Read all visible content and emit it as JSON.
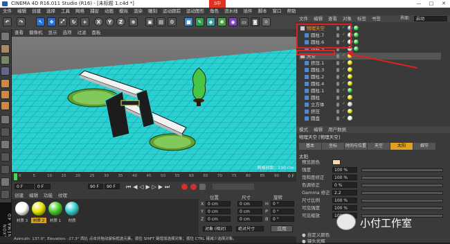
{
  "window": {
    "title": "CINEMA 4D R16.011 Studio (R16) - [未标题 1.c4d *]",
    "ime_label": "S中"
  },
  "menubar": [
    "文件",
    "编辑",
    "创建",
    "选择",
    "工具",
    "网格",
    "捕捉",
    "动画",
    "模拟",
    "渲染",
    "雕刻",
    "运动跟踪",
    "运动图形",
    "角色",
    "流水线",
    "插件",
    "脚本",
    "窗口",
    "帮助"
  ],
  "toolbar": {
    "xyz": [
      "X",
      "Y",
      "Z"
    ]
  },
  "viewport": {
    "menu": [
      "查看",
      "摄像机",
      "显示",
      "选项",
      "过滤",
      "面板"
    ],
    "grid_label": "网格间距：100 cm"
  },
  "timeline": {
    "ticks": [
      "0",
      "5",
      "10",
      "15",
      "20",
      "25",
      "30",
      "35",
      "40",
      "45",
      "50",
      "55",
      "60",
      "65",
      "70",
      "75",
      "80",
      "85",
      "90"
    ],
    "end": "0 F"
  },
  "transport": {
    "start": "0 F",
    "current": "0 F",
    "end": "90 F",
    "end2": "90 F"
  },
  "materials": {
    "menu": [
      "创建",
      "编辑",
      "功能",
      "纹理"
    ],
    "items": [
      {
        "name": "材质 3",
        "color": "#ffffff"
      },
      {
        "name": "材质 2",
        "color": "#e6e600"
      },
      {
        "name": "材质 1",
        "color": "#44cc22"
      },
      {
        "name": "材质",
        "color": "#33cccc"
      }
    ]
  },
  "coords": {
    "headers": [
      "位置",
      "尺寸",
      "旋转"
    ],
    "rows": [
      {
        "axis": "X",
        "pos": "0 cm",
        "size": "0 cm",
        "rlabel": "H",
        "rot": "0 °"
      },
      {
        "axis": "Y",
        "pos": "0 cm",
        "size": "0 cm",
        "rlabel": "P",
        "rot": "0 °"
      },
      {
        "axis": "Z",
        "pos": "0 cm",
        "size": "0 cm",
        "rlabel": "B",
        "rot": "0 °"
      }
    ],
    "mode": "对象 (相对)",
    "size_mode": "绝对尺寸",
    "apply": "应用"
  },
  "status": "Azimuth: 137.0°, Elevation: -27.3° 西比   点击并拖动鼠标框选元素。按住 SHIFT 键增加选择对象；按住 CTRL 键减少选择对象。",
  "objmgr": {
    "menu": [
      "文件",
      "编辑",
      "查看",
      "对象",
      "标签",
      "书签"
    ],
    "layout_label": "界面:",
    "layout_value": "启动",
    "rows": [
      {
        "name": "物理天空",
        "indent": 0,
        "tags": [
          "#4ad",
          "#3c3"
        ]
      },
      {
        "name": "圆柱.7",
        "indent": 1,
        "tags": [
          "#ccc",
          "#3c3"
        ]
      },
      {
        "name": "圆柱.6",
        "indent": 1,
        "tags": [
          "#ccc",
          "#3c3"
        ]
      },
      {
        "name": "圆柱.5",
        "indent": 1,
        "tags": [
          "#ccc",
          "#3c3"
        ]
      },
      {
        "name": "天空",
        "indent": 0,
        "tags": [
          "#fc0"
        ]
      },
      {
        "name": "挤压.1",
        "indent": 1,
        "tags": [
          "#dd0"
        ]
      },
      {
        "name": "圆柱.3",
        "indent": 1,
        "tags": [
          "#dd0"
        ]
      },
      {
        "name": "圆柱.2",
        "indent": 1,
        "tags": [
          "#dd0"
        ]
      },
      {
        "name": "圆柱.4",
        "indent": 1,
        "tags": [
          "#dd0"
        ]
      },
      {
        "name": "圆柱.1",
        "indent": 1,
        "tags": [
          "#3c3"
        ]
      },
      {
        "name": "圆柱",
        "indent": 1,
        "tags": [
          "#dd0"
        ]
      },
      {
        "name": "立方体",
        "indent": 1,
        "tags": [
          "#ccc"
        ]
      },
      {
        "name": "挤压",
        "indent": 1,
        "tags": [
          "#dd0"
        ]
      },
      {
        "name": "圆盘",
        "indent": 1,
        "tags": [
          "#eee"
        ]
      }
    ]
  },
  "attrmgr": {
    "menu": [
      "模式",
      "编辑",
      "用户数据"
    ],
    "object": "物理天空 [物理天空]",
    "tabs": [
      "基本",
      "坐标",
      "时间与位置",
      "天空",
      "太阳",
      "细节"
    ],
    "section": "太阳",
    "params": [
      {
        "label": "预览颜色",
        "value": ""
      },
      {
        "label": "强度",
        "value": "100 %"
      },
      {
        "label": "饱和度修正",
        "value": "100 %"
      },
      {
        "label": "色调修正",
        "value": "0 %"
      },
      {
        "label": "Gamma 修正",
        "value": "2.2"
      },
      {
        "label": "尺寸比例",
        "value": "100 %"
      },
      {
        "label": "可见强度",
        "value": "100 %"
      },
      {
        "label": "可见缩放",
        "value": "100 %"
      }
    ],
    "extra": [
      "● 自定义颜色",
      "● 镜头光辉"
    ]
  },
  "watermark": "小付工作室"
}
